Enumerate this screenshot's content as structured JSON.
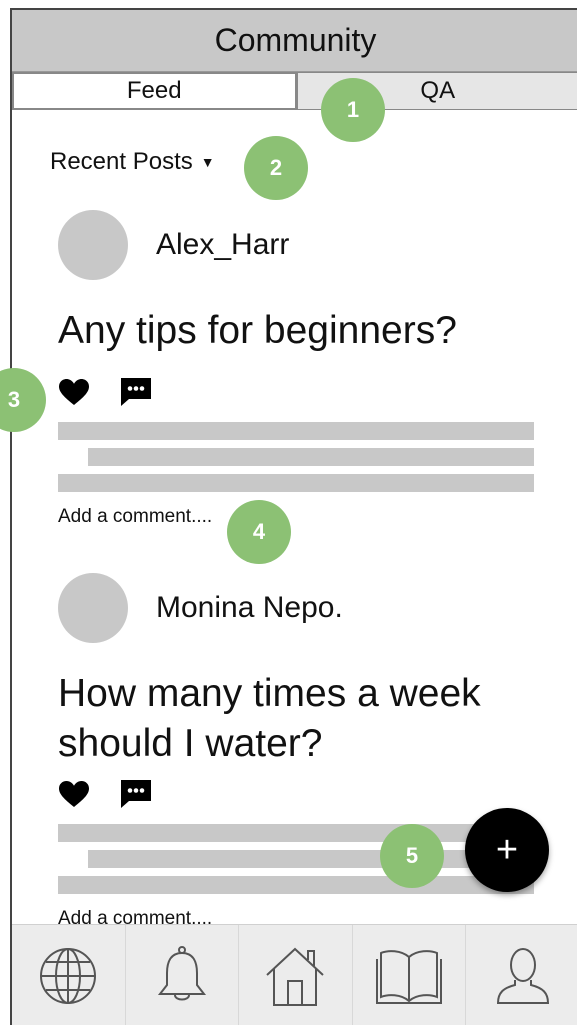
{
  "app": {
    "title": "Community"
  },
  "tabs": [
    {
      "label": "Feed"
    },
    {
      "label": "QA"
    }
  ],
  "sort": {
    "label": "Recent Posts"
  },
  "posts": [
    {
      "author": "Alex_Harr",
      "question": "Any tips for beginners?",
      "comment_placeholder": "Add a comment...."
    },
    {
      "author": "Monina Nepo.",
      "question": "How many times a week should I water?",
      "comment_placeholder": "Add a comment...."
    }
  ],
  "fab": {
    "label": "+"
  },
  "annotations": [
    {
      "label": "1"
    },
    {
      "label": "2"
    },
    {
      "label": "3"
    },
    {
      "label": "4"
    },
    {
      "label": "5"
    }
  ],
  "nav": [
    {
      "icon": "globe-icon"
    },
    {
      "icon": "bell-icon"
    },
    {
      "icon": "home-icon"
    },
    {
      "icon": "book-icon"
    },
    {
      "icon": "user-icon"
    }
  ],
  "colors": {
    "header": "#c8c8c8",
    "placeholder_gray": "#c8c8c8",
    "annotation": "#8cc174",
    "fab": "#000000"
  }
}
